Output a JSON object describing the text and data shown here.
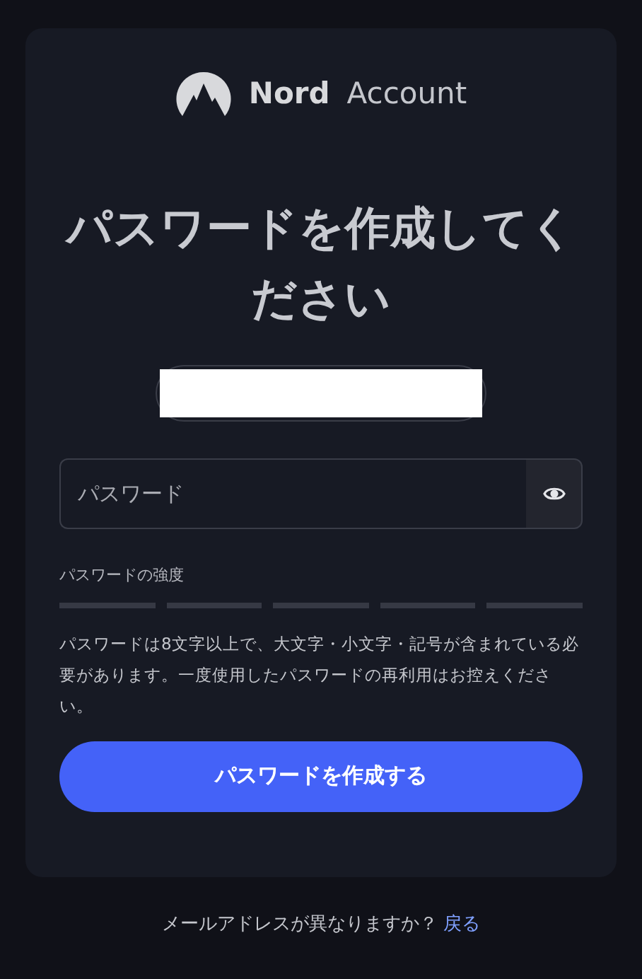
{
  "logo": {
    "brand": "Nord",
    "product": "Account"
  },
  "title": "パスワードを作成してください",
  "email_chip": {
    "redacted": true
  },
  "password_field": {
    "placeholder": "パスワード",
    "visible": false
  },
  "strength": {
    "label": "パスワードの強度"
  },
  "hint": "パスワードは8文字以上で、大文字・小文字・記号が含まれている必要があります。一度使用したパスワードの再利用はお控えください。",
  "submit_button": "パスワードを作成する",
  "footer": {
    "question": "メールアドレスが異なりますか？",
    "link": "戻る"
  }
}
